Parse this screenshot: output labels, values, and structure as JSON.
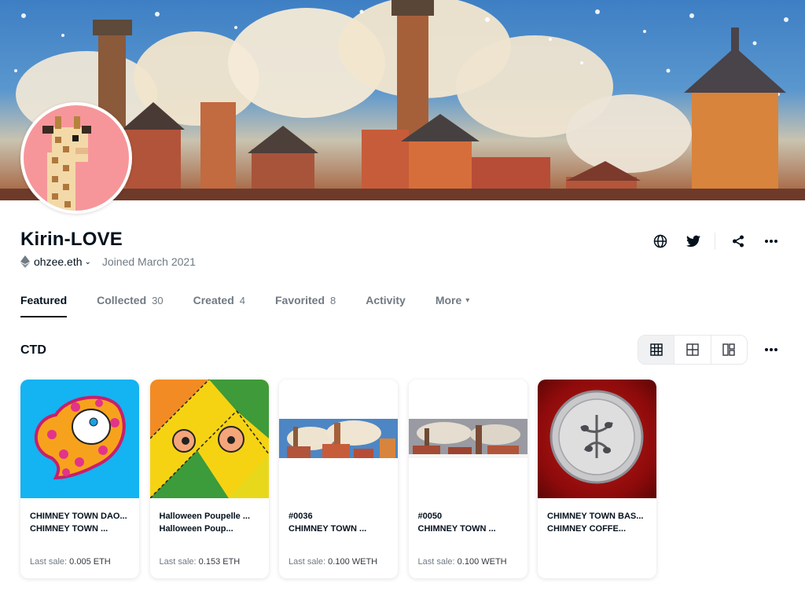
{
  "profile": {
    "name": "Kirin-LOVE",
    "wallet": "ohzee.eth",
    "joined": "Joined March 2021"
  },
  "actions": {
    "icons": [
      "globe-icon",
      "twitter-icon",
      "share-icon",
      "more-icon"
    ]
  },
  "tabs": [
    {
      "label": "Featured",
      "count": ""
    },
    {
      "label": "Collected",
      "count": "30"
    },
    {
      "label": "Created",
      "count": "4"
    },
    {
      "label": "Favorited",
      "count": "8"
    },
    {
      "label": "Activity",
      "count": ""
    },
    {
      "label": "More",
      "count": ""
    }
  ],
  "section": {
    "title": "CTD",
    "view_icons": [
      "grid-large-icon",
      "grid-small-icon",
      "mosaic-icon"
    ]
  },
  "cards": [
    {
      "line1": "CHIMNEY TOWN DAO...",
      "line2": "CHIMNEY TOWN ...",
      "sale_label": "Last sale:",
      "sale_value": "0.005 ETH"
    },
    {
      "line1": "Halloween Poupelle ...",
      "line2": "Halloween Poup...",
      "sale_label": "Last sale:",
      "sale_value": "0.153 ETH"
    },
    {
      "line1": "#0036",
      "line2": "CHIMNEY TOWN ...",
      "sale_label": "Last sale:",
      "sale_value": "0.100 WETH"
    },
    {
      "line1": "#0050",
      "line2": "CHIMNEY TOWN ...",
      "sale_label": "Last sale:",
      "sale_value": "0.100 WETH"
    },
    {
      "line1": "CHIMNEY TOWN BAS...",
      "line2": "CHIMNEY COFFE...",
      "sale_label": "",
      "sale_value": ""
    }
  ],
  "colors": {
    "accent": "#04111d",
    "muted": "#707a83",
    "avatar_bg": "#f6969a"
  }
}
